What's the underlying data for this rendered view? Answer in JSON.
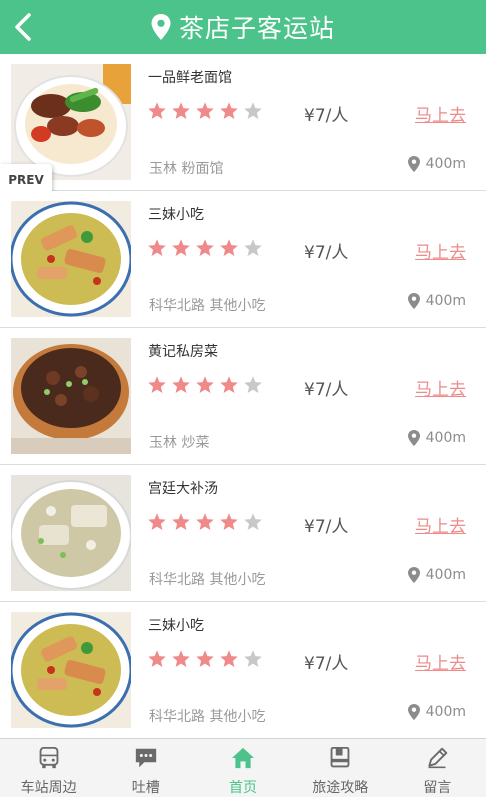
{
  "header": {
    "title": "茶店子客运站",
    "back_icon": "chevron-left-icon",
    "location_icon": "map-pin-icon",
    "color": "#4cc38a"
  },
  "prev_label": "PREV",
  "restaurants": [
    {
      "name": "一品鲜老面馆",
      "rating": 4,
      "max_rating": 5,
      "price": "¥7/人",
      "go_label": "马上去",
      "area": "玉林 粉面馆",
      "distance": "400m"
    },
    {
      "name": "三妹小吃",
      "rating": 4,
      "max_rating": 5,
      "price": "¥7/人",
      "go_label": "马上去",
      "area": "科华北路 其他小吃",
      "distance": "400m"
    },
    {
      "name": "黄记私房菜",
      "rating": 4,
      "max_rating": 5,
      "price": "¥7/人",
      "go_label": "马上去",
      "area": "玉林 炒菜",
      "distance": "400m"
    },
    {
      "name": "宫廷大补汤",
      "rating": 4,
      "max_rating": 5,
      "price": "¥7/人",
      "go_label": "马上去",
      "area": "科华北路 其他小吃",
      "distance": "400m"
    },
    {
      "name": "三妹小吃",
      "rating": 4,
      "max_rating": 5,
      "price": "¥7/人",
      "go_label": "马上去",
      "area": "科华北路 其他小吃",
      "distance": "400m"
    }
  ],
  "colors": {
    "star_on": "#f08a8a",
    "star_off": "#c8c8c8",
    "link": "#ef8a8a",
    "active_tab": "#4cc38a"
  },
  "tabs": [
    {
      "label": "车站周边",
      "icon": "bus-icon",
      "active": false
    },
    {
      "label": "吐槽",
      "icon": "chat-bubble-icon",
      "active": false
    },
    {
      "label": "首页",
      "icon": "home-icon",
      "active": true
    },
    {
      "label": "旅途攻略",
      "icon": "book-icon",
      "active": false
    },
    {
      "label": "留言",
      "icon": "pencil-icon",
      "active": false
    }
  ]
}
